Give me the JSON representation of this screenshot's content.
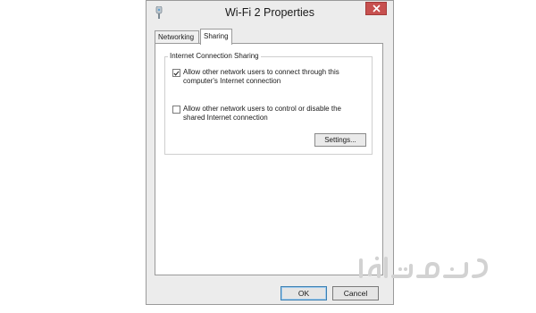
{
  "window": {
    "title": "Wi-Fi 2 Properties",
    "icon": "network-adapter-icon",
    "close_icon": "close-icon",
    "close_color": "#c7504f"
  },
  "tabs": [
    {
      "label": "Networking",
      "active": false
    },
    {
      "label": "Sharing",
      "active": true
    }
  ],
  "sharing": {
    "group_title": "Internet Connection Sharing",
    "options": [
      {
        "label": "Allow other network users to connect through this computer's Internet connection",
        "checked": true
      },
      {
        "label": "Allow other network users to control or disable the shared Internet connection",
        "checked": false
      }
    ],
    "settings_label": "Settings..."
  },
  "buttons": {
    "ok_label": "OK",
    "cancel_label": "Cancel"
  },
  "watermark": {
    "text": "خدمت ازما"
  }
}
